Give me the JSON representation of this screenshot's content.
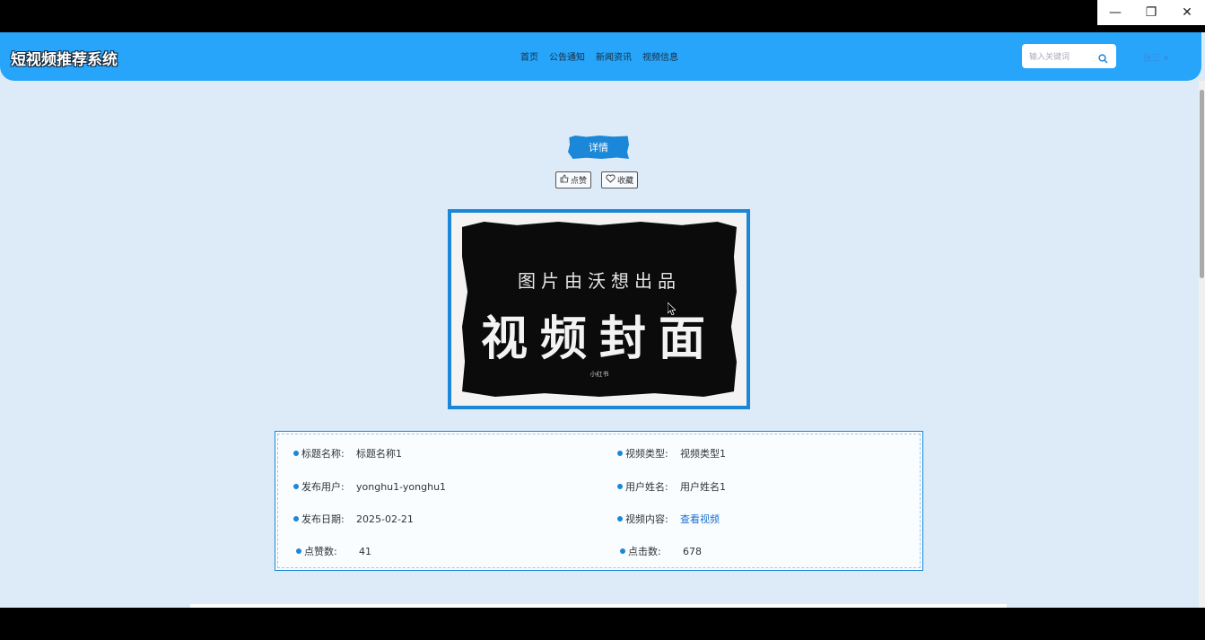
{
  "window": {
    "controls": {
      "minimize": "—",
      "restore": "❐",
      "close": "✕"
    }
  },
  "navbar": {
    "brand": "短视频推荐系统",
    "menu": [
      {
        "label": "首页"
      },
      {
        "label": "公告通知"
      },
      {
        "label": "新闻资讯"
      },
      {
        "label": "视频信息"
      }
    ],
    "search_placeholder": "输入关键词",
    "user_label": "张三 ▾"
  },
  "detail": {
    "tag": "详情",
    "like_label": "点赞",
    "favorite_label": "收藏"
  },
  "cover": {
    "subtitle": "图片由沃想出品",
    "title": "视频封面",
    "small": "小红书"
  },
  "info": {
    "title_label": "标题名称:",
    "title_value": "标题名称1",
    "type_label": "视频类型:",
    "type_value": "视频类型1",
    "publisher_label": "发布用户:",
    "publisher_value": "yonghu1-yonghu1",
    "username_label": "用户姓名:",
    "username_value": "用户姓名1",
    "date_label": "发布日期:",
    "date_value": "2025-02-21",
    "content_label": "视频内容:",
    "content_value": "查看视频",
    "likes_label": "点赞数:",
    "likes_value": "41",
    "clicks_label": "点击数:",
    "clicks_value": "678"
  },
  "colors": {
    "navbar": "#26a5fb",
    "accent": "#1b87d8",
    "background": "#ddeaf7"
  }
}
